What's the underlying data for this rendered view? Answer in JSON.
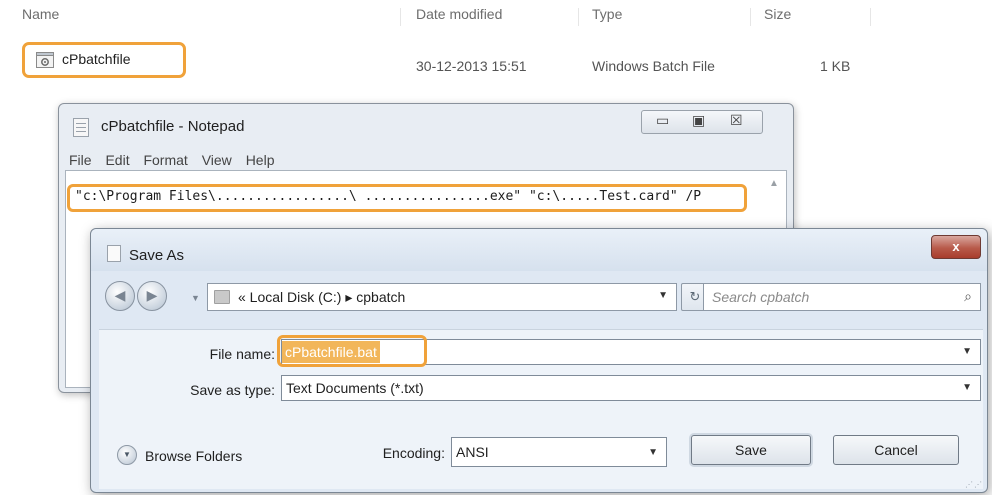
{
  "explorer": {
    "columns": [
      "Name",
      "Date modified",
      "Type",
      "Size"
    ],
    "file": {
      "name": "cPbatchfile",
      "date_modified": "30-12-2013 15:51",
      "type": "Windows Batch File",
      "size": "1 KB",
      "icon": "batch-file-icon"
    }
  },
  "notepad": {
    "title": "cPbatchfile - Notepad",
    "controls": [
      "▭",
      "▣",
      "☒"
    ],
    "menu": [
      "File",
      "Edit",
      "Format",
      "View",
      "Help"
    ],
    "content": "\"c:\\Program Files\\.................\\ ................exe\" \"c:\\.....Test.card\" /P"
  },
  "save_dialog": {
    "title": "Save As",
    "close_label": "x",
    "path": "« Local Disk (C:) ▸ cpbatch",
    "search_placeholder": "Search cpbatch",
    "file_name_label": "File name:",
    "file_name_value": "cPbatchfile.bat",
    "save_type_label": "Save as type:",
    "save_type_value": "Text Documents (*.txt)",
    "browse_label": "Browse Folders",
    "encoding_label": "Encoding:",
    "encoding_value": "ANSI",
    "save_label": "Save",
    "cancel_label": "Cancel"
  },
  "colors": {
    "highlight_outline": "#f0a23a",
    "selection": "#f2b65a",
    "close_button": "#b85a4a"
  }
}
